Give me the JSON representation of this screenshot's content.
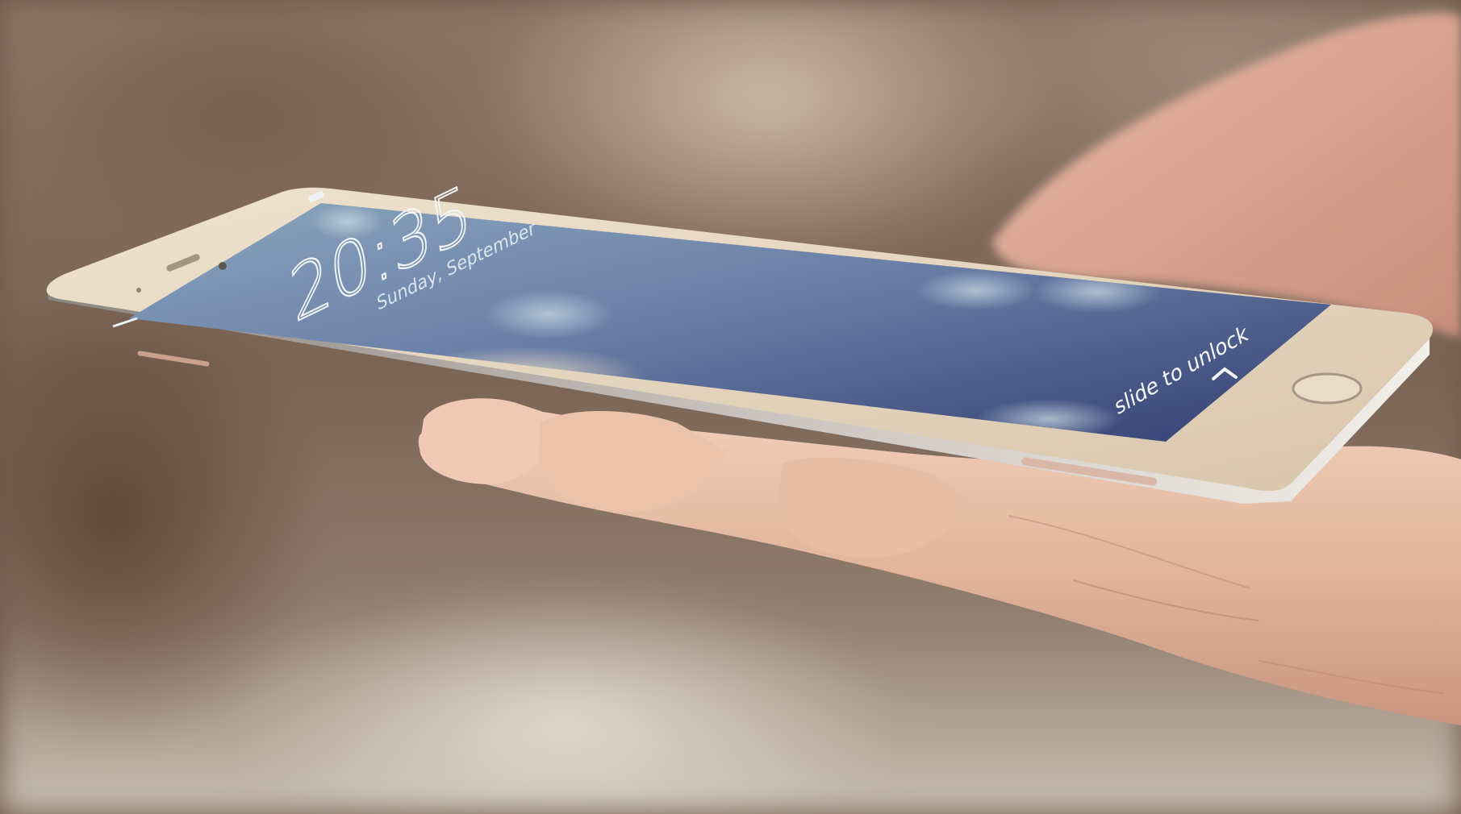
{
  "lockscreen": {
    "time": "20:35",
    "date": "Sunday, September",
    "unlock_hint": "slide to unlock"
  },
  "colors": {
    "screen_top": "#7e9cb5",
    "screen_bottom": "#3d4a7a",
    "bezel": "#e7d9c2",
    "frame": "#b9b2ad",
    "skin": "#e3b9a2"
  },
  "icons": {
    "home_button": "home-button-ring",
    "unlock_chevron": "chevron-up"
  }
}
